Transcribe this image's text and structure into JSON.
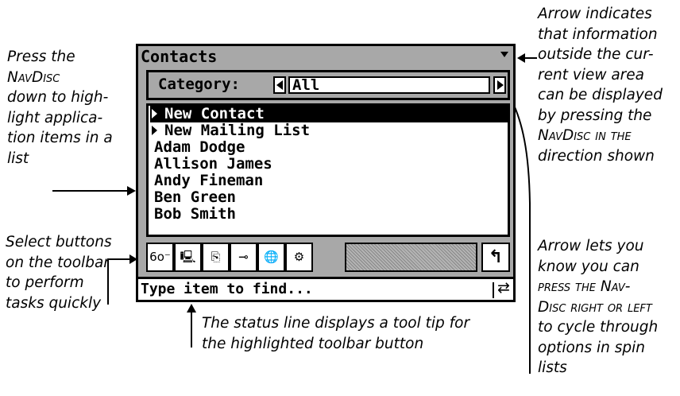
{
  "callouts": {
    "navdisc_highlight": [
      "Press the",
      "NavDisc",
      "down to high-",
      "light applica-",
      "tion items in a",
      "list"
    ],
    "toolbar_buttons": [
      "Select buttons",
      "on the toolbar",
      "to perform",
      "tasks quickly"
    ],
    "status_line": [
      "The status line displays a tool tip for",
      "the highlighted toolbar button"
    ],
    "scroll_arrow": [
      "Arrow indicates",
      "that information",
      "outside the cur-",
      "rent view area",
      "can be displayed",
      "by pressing the",
      "NavDisc in the",
      "direction shown"
    ],
    "spin_arrow": [
      "Arrow lets you",
      "know you can",
      "press the Nav-",
      "Disc right or left",
      "to cycle through",
      "options in spin",
      "lists"
    ]
  },
  "device": {
    "title": "Contacts",
    "category": {
      "label": "Category:",
      "value": "All"
    },
    "list": {
      "items": [
        {
          "label": "New Contact",
          "marker": true,
          "selected": true
        },
        {
          "label": "New Mailing List",
          "marker": true,
          "selected": false
        },
        {
          "label": "Adam Dodge"
        },
        {
          "label": "Allison James"
        },
        {
          "label": "Andy Fineman"
        },
        {
          "label": "Ben Green"
        },
        {
          "label": "Bob Smith"
        }
      ]
    },
    "toolbar": {
      "buttons": [
        {
          "icon": "glasses-icon",
          "glyph": "6o⁻"
        },
        {
          "icon": "send-icon",
          "glyph": "🖳"
        },
        {
          "icon": "copy-to-folder-icon",
          "glyph": "⎘"
        },
        {
          "icon": "hierarchy-icon",
          "glyph": "⊸"
        },
        {
          "icon": "globe-icon",
          "glyph": "🌐"
        },
        {
          "icon": "settings-icon",
          "glyph": "⚙"
        }
      ],
      "back_icon": "back-arrow-icon",
      "back_glyph": "↰"
    },
    "status": {
      "text": "Type item to find...",
      "toggle_glyph": "⇄"
    }
  }
}
